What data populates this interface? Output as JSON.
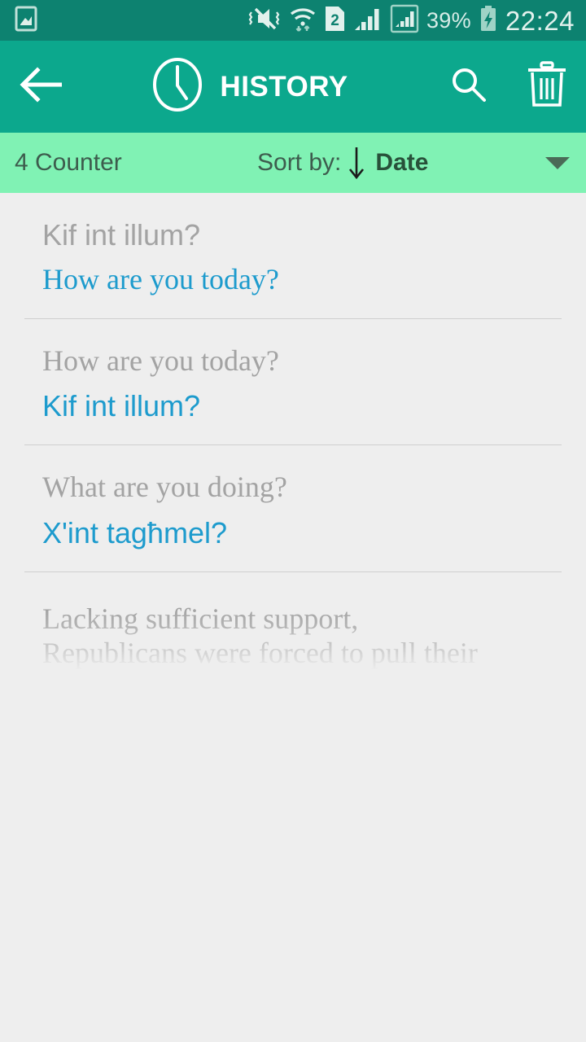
{
  "status_bar": {
    "icons": [
      "screenshot-image-icon",
      "vibrate-mute-icon",
      "wifi-icon",
      "sim-2-icon",
      "signal-bars-icon",
      "signal-bars-boxed-icon"
    ],
    "sim_label": "2",
    "battery_percent": "39%",
    "clock": "22:24",
    "background": "#0d8270"
  },
  "app_bar": {
    "title": "HISTORY",
    "clock_icon": "clock-icon",
    "back_icon": "back-arrow-icon",
    "search_icon": "search-icon",
    "delete_icon": "trash-icon",
    "background": "#0ca88d"
  },
  "sort_bar": {
    "count_label": "4 Counter",
    "sort_by_label": "Sort by:",
    "direction_icon": "arrow-down-icon",
    "sort_value": "Date",
    "caret_icon": "chevron-down-icon",
    "background": "#80f2b4"
  },
  "history": {
    "items": [
      {
        "source": "Kif int illum?",
        "source_style": "sans",
        "target": "How are you today?",
        "target_style": "serif"
      },
      {
        "source": "How are you today?",
        "source_style": "serif",
        "target": "Kif int illum?",
        "target_style": "sans"
      },
      {
        "source": "What are you doing?",
        "source_style": "serif",
        "target": "X'int tagħmel?",
        "target_style": "sans"
      }
    ],
    "faded_item": {
      "text": "Lacking sufficient support,\nRepublicans were forced to pull their"
    },
    "source_color": "#a3a3a3",
    "target_color": "#1d9bcd",
    "background": "#eeeeee"
  }
}
